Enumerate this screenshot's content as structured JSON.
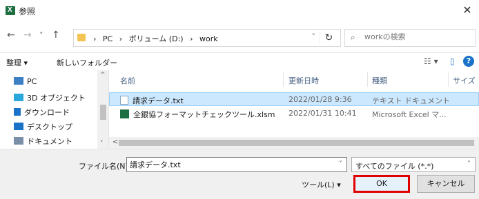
{
  "window": {
    "title": "参照",
    "close_glyph": "✕"
  },
  "nav": {
    "back": "←",
    "forward": "→",
    "recent": "˅",
    "up": "↑",
    "crumbs": [
      "›",
      "PC",
      "›",
      "ボリューム (D:)",
      "›",
      "work"
    ],
    "dropdown": "˅",
    "refresh": "↻",
    "search_placeholder": "workの検索",
    "search_icon": "⌕"
  },
  "commands": {
    "organize": "整理 ▾",
    "new_folder": "新しいフォルダー",
    "view_glyph": "☷ ▾",
    "pane_glyph": "▯",
    "help": "?"
  },
  "sidebar": {
    "items": [
      {
        "label": "PC",
        "icon": "pc-icon",
        "color": "#3b7fc4"
      },
      {
        "label": "3D オブジェクト",
        "icon": "cube-icon",
        "color": "#2aa8dc"
      },
      {
        "label": "ダウンロード",
        "icon": "download-icon",
        "color": "#1a73c8"
      },
      {
        "label": "デスクトップ",
        "icon": "desktop-icon",
        "color": "#1a73c8"
      },
      {
        "label": "ドキュメント",
        "icon": "document-icon",
        "color": "#7a8ea8"
      }
    ],
    "scroll_up": "^",
    "scroll_down": "˅"
  },
  "files": {
    "columns": {
      "name": "名前",
      "date": "更新日時",
      "type": "種類",
      "size": "サイズ",
      "sort_glyph": "^"
    },
    "rows": [
      {
        "name": "請求データ.txt",
        "date": "2022/01/28 9:36",
        "type": "テキスト ドキュメント",
        "icon": "text-file-icon",
        "selected": true
      },
      {
        "name": "全銀協フォーマットチェックツール.xlsm",
        "date": "2022/01/31 10:41",
        "type": "Microsoft Excel マ...",
        "icon": "excel-file-icon",
        "selected": false
      }
    ],
    "hscroll_left": "<",
    "hscroll_right": ">"
  },
  "footer": {
    "filename_label": "ファイル名(N):",
    "filename_value": "請求データ.txt",
    "filetype": "すべてのファイル (*.*)",
    "dropdown": "˅",
    "tools": "ツール(L)  ▾",
    "ok": "OK",
    "cancel": "キャンセル"
  },
  "colors": {
    "highlight": "#e00000",
    "selection": "#cce8ff",
    "accent": "#1a73c8"
  }
}
